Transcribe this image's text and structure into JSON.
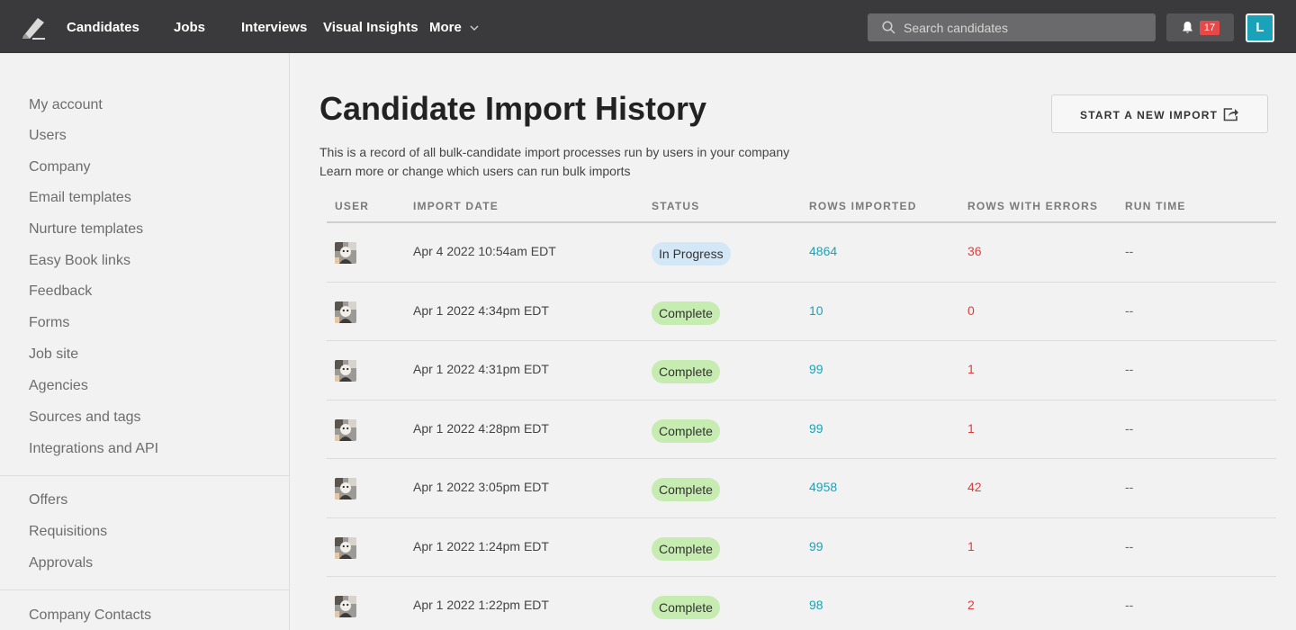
{
  "nav": {
    "logo": "lever-logo-icon",
    "links": [
      "Candidates",
      "Jobs",
      "Interviews",
      "Visual Insights",
      "More"
    ],
    "search_placeholder": "Search candidates",
    "notifications_count": "17",
    "user_initial": "L"
  },
  "sidebar": {
    "group1": [
      "My account",
      "Users",
      "Company",
      "Email templates",
      "Nurture templates",
      "Easy Book links",
      "Feedback",
      "Forms",
      "Job site",
      "Agencies",
      "Sources and tags",
      "Integrations and API"
    ],
    "group2": [
      "Offers",
      "Requisitions",
      "Approvals"
    ],
    "group3": [
      "Company Contacts"
    ]
  },
  "page": {
    "title": "Candidate Import History",
    "desc_line1": "This is a record of all bulk-candidate import processes run by users in your company",
    "desc_line2": "Learn more or change which users can run bulk imports",
    "import_button": "START A NEW IMPORT"
  },
  "table": {
    "headers": [
      "USER",
      "IMPORT DATE",
      "STATUS",
      "ROWS IMPORTED",
      "ROWS WITH ERRORS",
      "RUN TIME"
    ],
    "rows": [
      {
        "date": "Apr 4 2022 10:54am EDT",
        "status": "In Progress",
        "rows": "4864",
        "errors": "36",
        "runtime": "--"
      },
      {
        "date": "Apr 1 2022 4:34pm EDT",
        "status": "Complete",
        "rows": "10",
        "errors": "0",
        "runtime": "--"
      },
      {
        "date": "Apr 1 2022 4:31pm EDT",
        "status": "Complete",
        "rows": "99",
        "errors": "1",
        "runtime": "--"
      },
      {
        "date": "Apr 1 2022 4:28pm EDT",
        "status": "Complete",
        "rows": "99",
        "errors": "1",
        "runtime": "--"
      },
      {
        "date": "Apr 1 2022 3:05pm EDT",
        "status": "Complete",
        "rows": "4958",
        "errors": "42",
        "runtime": "--"
      },
      {
        "date": "Apr 1 2022 1:24pm EDT",
        "status": "Complete",
        "rows": "99",
        "errors": "1",
        "runtime": "--"
      },
      {
        "date": "Apr 1 2022 1:22pm EDT",
        "status": "Complete",
        "rows": "98",
        "errors": "2",
        "runtime": "--"
      }
    ]
  },
  "colors": {
    "nav_bg": "#3a3a3c",
    "accent": "#1aa3b8",
    "error": "#e03c3c",
    "in_progress_bg": "#d3e7f7",
    "complete_bg": "#c7ecb1"
  }
}
